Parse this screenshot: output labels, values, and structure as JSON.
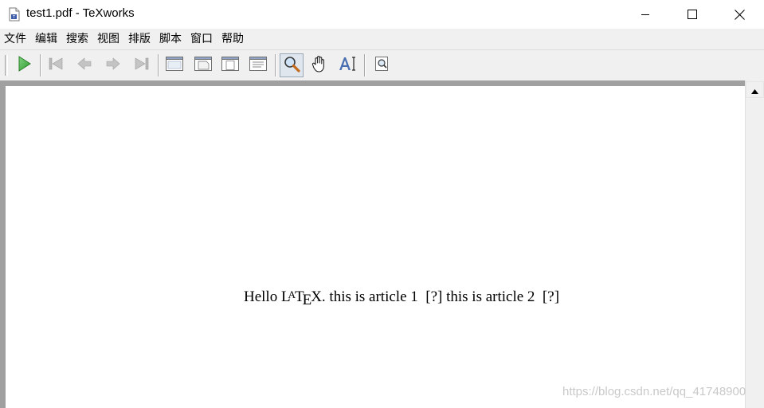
{
  "window": {
    "title": "test1.pdf - TeXworks",
    "controls": {
      "minimize": "minimize-icon",
      "maximize": "maximize-icon",
      "close": "close-icon"
    }
  },
  "menu": {
    "items": [
      {
        "label": "文件"
      },
      {
        "label": "编辑"
      },
      {
        "label": "搜索"
      },
      {
        "label": "视图"
      },
      {
        "label": "排版"
      },
      {
        "label": "脚本"
      },
      {
        "label": "窗口"
      },
      {
        "label": "帮助"
      }
    ]
  },
  "toolbar": {
    "buttons": [
      {
        "icon": "typeset-play-icon",
        "color": "#3aa53a"
      },
      {
        "icon": "first-page-icon",
        "disabled": true
      },
      {
        "icon": "previous-page-icon",
        "disabled": true
      },
      {
        "icon": "next-page-icon",
        "disabled": true
      },
      {
        "icon": "last-page-icon",
        "disabled": true
      },
      {
        "icon": "actual-size-icon"
      },
      {
        "icon": "fit-width-icon"
      },
      {
        "icon": "fit-window-icon"
      },
      {
        "icon": "fit-content-icon"
      },
      {
        "icon": "magnify-icon",
        "active": true
      },
      {
        "icon": "hand-scroll-icon"
      },
      {
        "icon": "text-select-icon"
      },
      {
        "icon": "find-icon"
      }
    ]
  },
  "document": {
    "text_before": "Hello ",
    "latex_logo": {
      "L": "L",
      "A": "A",
      "T": "T",
      "E": "E",
      "X": "X"
    },
    "text_after": ". this is article 1  [?] this is article 2  [?]"
  },
  "watermark": "https://blog.csdn.net/qq_41748900",
  "colors": {
    "titlebar": "#ffffff",
    "chrome": "#f0f0f0",
    "doc_background": "#a0a0a0",
    "page": "#ffffff"
  }
}
